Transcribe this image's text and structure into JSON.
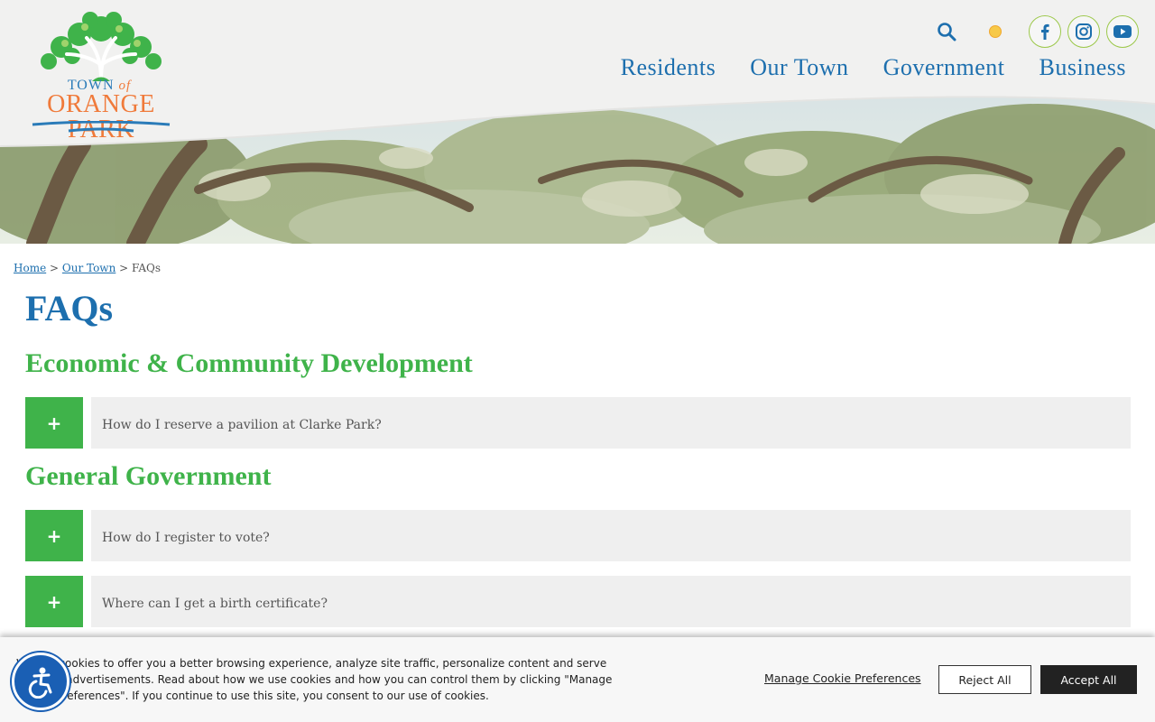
{
  "header": {
    "logo": {
      "town": "TOWN",
      "of": "of",
      "name": "ORANGE PARK"
    },
    "utility": {
      "search": "search-icon",
      "weather": "sun-icon"
    },
    "social": [
      "facebook-icon",
      "instagram-icon",
      "youtube-icon"
    ],
    "nav": [
      "Residents",
      "Our Town",
      "Government",
      "Business"
    ]
  },
  "breadcrumb": {
    "home": "Home",
    "sep1": ">",
    "parent": "Our Town",
    "sep2": ">",
    "current": "FAQs"
  },
  "page": {
    "title": "FAQs"
  },
  "sections": [
    {
      "title": "Economic & Community Development",
      "items": [
        {
          "toggle": "+",
          "question": "How do I reserve a pavilion at Clarke Park?"
        }
      ]
    },
    {
      "title": "General Government",
      "items": [
        {
          "toggle": "+",
          "question": "How do I register to vote?"
        },
        {
          "toggle": "+",
          "question": "Where can I get a birth certificate?"
        }
      ]
    }
  ],
  "cookie": {
    "text": "We use cookies to offer you a better browsing experience, analyze site traffic, personalize content and serve targeted advertisements. Read about how we use cookies and how you can control them by clicking \"Manage Cookie Preferences\". If you continue to use this site, you consent to our use of cookies.",
    "manage": "Manage Cookie Preferences",
    "reject": "Reject All",
    "accept": "Accept All"
  },
  "accessibility": {
    "icon": "accessibility-icon"
  },
  "colors": {
    "blue": "#1d6fae",
    "green": "#3fb34a",
    "orange": "#f07a3a",
    "row_bg": "#efefef"
  }
}
